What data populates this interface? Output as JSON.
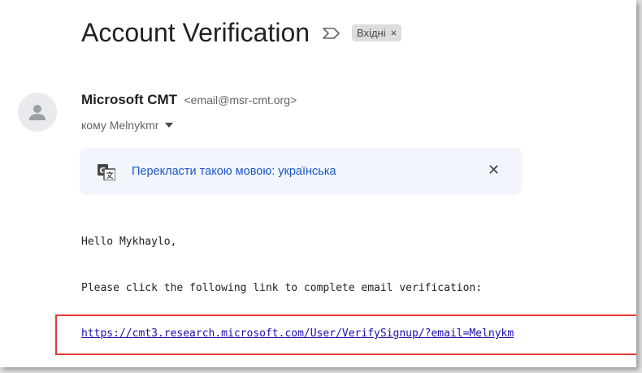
{
  "email": {
    "subject": "Account Verification",
    "label_chip": "Вхідні",
    "label_chip_close": "×",
    "sender_name": "Microsoft CMT",
    "sender_email": "<email@msr-cmt.org>",
    "recipient": "кому Melnykmr",
    "translate_text": "Перекласти такою мовою: українська",
    "translate_close": "✕",
    "greeting": "Hello Mykhaylo,",
    "instruction": "Please click the following link to complete email verification:",
    "verify_link": "https://cmt3.research.microsoft.com/User/VerifySignup/?email=Melnykm"
  },
  "colors": {
    "link": "#1a0dab",
    "translate_link": "#1a57c6",
    "highlight_border": "#e53935",
    "translate_bar_bg": "#f2f6fc"
  },
  "icons": [
    "important-marker-icon",
    "avatar-person-icon",
    "translate-icon",
    "close-icon",
    "chevron-down-icon"
  ]
}
